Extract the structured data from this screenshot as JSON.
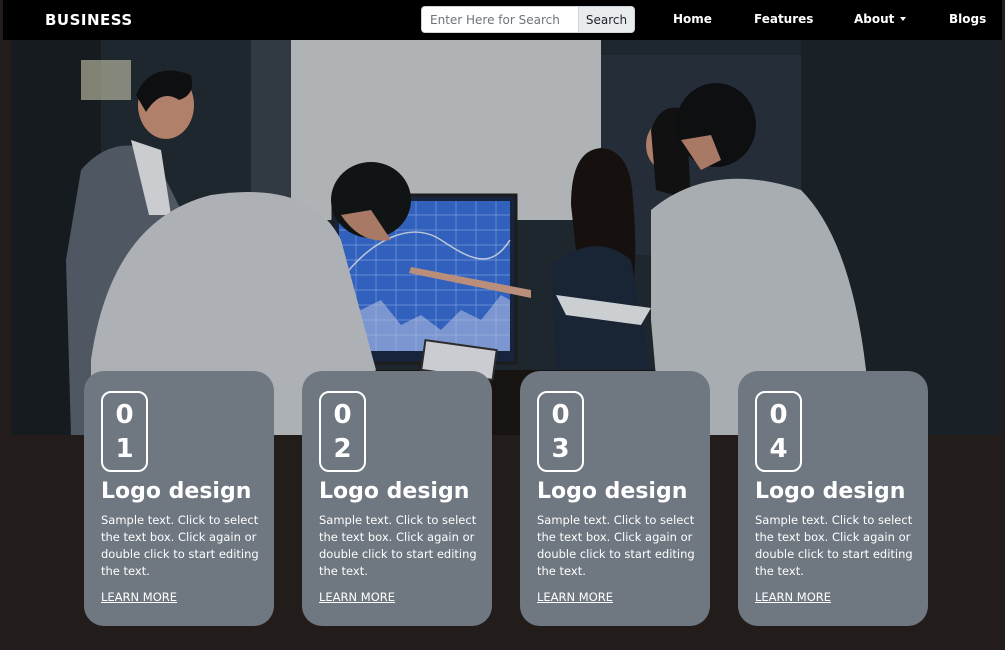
{
  "navbar": {
    "brand": "BUSINESS",
    "search": {
      "placeholder": "Enter Here for Search",
      "value": "",
      "button_label": "Search"
    },
    "links": {
      "home": "Home",
      "features": "Features",
      "about": "About",
      "blogs": "Blogs"
    }
  },
  "hero": {
    "image": "business-team-meeting-photo"
  },
  "cards": [
    {
      "digits": [
        "0",
        "1"
      ],
      "title": "Logo design",
      "text": "Sample text. Click to select the text box. Click again or double click to start editing the text.",
      "link": "LEARN MORE"
    },
    {
      "digits": [
        "0",
        "2"
      ],
      "title": "Logo design",
      "text": "Sample text. Click to select the text box. Click again or double click to start editing the text.",
      "link": "LEARN MORE"
    },
    {
      "digits": [
        "0",
        "3"
      ],
      "title": "Logo design",
      "text": "Sample text. Click to select the text box. Click again or double click to start editing the text.",
      "link": "LEARN MORE"
    },
    {
      "digits": [
        "0",
        "4"
      ],
      "title": "Logo design",
      "text": "Sample text. Click to select the text box. Click again or double click to start editing the text.",
      "link": "LEARN MORE"
    }
  ],
  "colors": {
    "navbar": "#000000",
    "page_bg": "#221d1b",
    "card_bg": "#6f7780",
    "text": "#ffffff"
  }
}
